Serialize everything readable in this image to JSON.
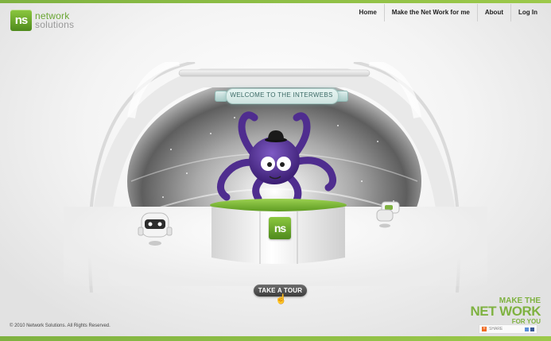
{
  "brand": {
    "logo_mark": "ns",
    "name_line1": "network",
    "name_line2": "solutions"
  },
  "nav": {
    "items": [
      "Home",
      "Make the Net Work for me",
      "About",
      "Log In"
    ]
  },
  "scene": {
    "welcome_text": "WELCOME TO THE INTERWEBS",
    "desk_logo": "ns"
  },
  "tour_button": "TAKE A TOUR",
  "tagline": {
    "line1": "MAKE THE",
    "line2": "NET WORK",
    "line3": "FOR YOU"
  },
  "share": {
    "label": "SHARE"
  },
  "footer": {
    "copyright": "© 2010 Network Solutions. All Rights Reserved."
  },
  "colors": {
    "brand_green": "#7fb241",
    "octopus_purple": "#4f2d8f",
    "button_dark": "#4a4a4a"
  },
  "icons": [
    "cursor-hand-icon",
    "robot-left-icon",
    "robot-right-icon",
    "octopus-mascot-icon",
    "share-plus-icon"
  ]
}
